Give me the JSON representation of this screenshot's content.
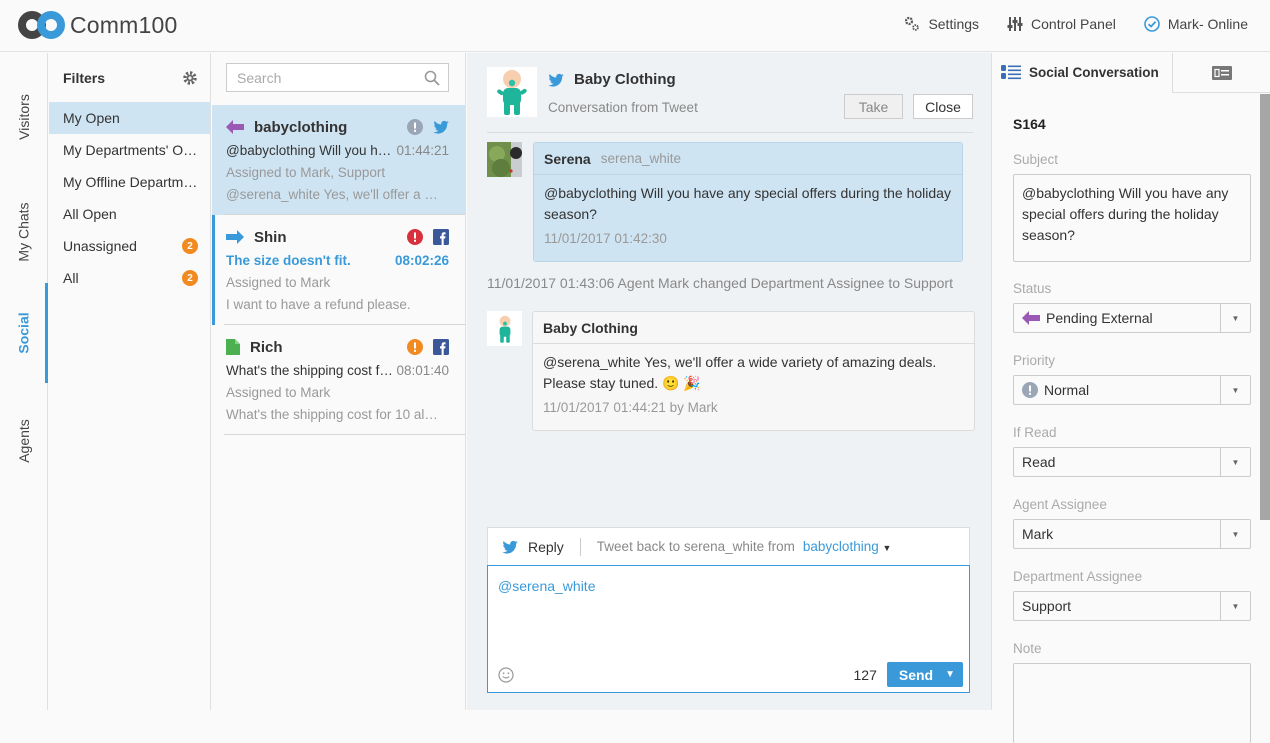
{
  "app": {
    "name": "Comm100"
  },
  "topbar": {
    "actions": [
      {
        "icon": "gears-icon",
        "label": "Settings"
      },
      {
        "icon": "sliders-icon",
        "label": "Control Panel"
      },
      {
        "icon": "check-circle-icon",
        "label": "Mark- Online"
      }
    ]
  },
  "vnav": {
    "items": [
      {
        "label": "Visitors",
        "active": false
      },
      {
        "label": "My Chats",
        "active": false
      },
      {
        "label": "Social",
        "active": true
      },
      {
        "label": "Agents",
        "active": false
      }
    ]
  },
  "filters": {
    "title": "Filters",
    "items": [
      {
        "label": "My Open",
        "active": true,
        "badge": null
      },
      {
        "label": "My Departments' Open",
        "badge": null
      },
      {
        "label": "My Offline Departme…",
        "badge": null
      },
      {
        "label": "All Open",
        "badge": null
      },
      {
        "label": "Unassigned",
        "badge": "2"
      },
      {
        "label": "All",
        "badge": "2"
      }
    ]
  },
  "list": {
    "search_placeholder": "Search",
    "conversations": [
      {
        "name": "babyclothing",
        "status": "pending-external",
        "priority": "normal",
        "channel": "twitter",
        "message": "@babyclothing Will you h…",
        "time": "01:44:21",
        "assigned": "Assigned to Mark, Support",
        "last": "@serena_white Yes, we'll offer a …"
      },
      {
        "name": "Shin",
        "status": "pending-internal",
        "priority": "urgent",
        "channel": "facebook",
        "message": "The size doesn't fit.",
        "time": "08:02:26",
        "assigned": "Assigned to Mark",
        "last": "I want to have a refund please."
      },
      {
        "name": "Rich",
        "status": "new",
        "priority": "high",
        "channel": "facebook",
        "message": "What's the shipping cost f…",
        "time": "08:01:40",
        "assigned": "Assigned to Mark",
        "last": "What's the shipping cost for 10 al…"
      }
    ]
  },
  "chat": {
    "title": "Baby Clothing",
    "subtitle": "Conversation from Tweet",
    "take_label": "Take",
    "close_label": "Close",
    "messages": [
      {
        "author": "Serena",
        "handle": "serena_white",
        "text": "@babyclothing Will you have any special offers during the holiday season?",
        "time": "11/01/2017 01:42:30"
      },
      {
        "author": "Baby Clothing",
        "text": "@serena_white Yes, we'll  offer a wide variety of amazing deals.",
        "text2": "Please stay tuned.",
        "emoji": "🙂 🎉",
        "time": "11/01/2017 01:44:21 by Mark"
      }
    ],
    "system_message": "11/01/2017 01:43:06 Agent Mark changed Department Assignee to Support",
    "reply": {
      "tab_label": "Reply",
      "target": "Tweet back to serena_white from",
      "from_account": "babyclothing",
      "value": "@serena_white",
      "remaining": "127",
      "send_label": "Send"
    }
  },
  "side": {
    "tab_label": "Social Conversation",
    "case_id": "S164",
    "subject_label": "Subject",
    "subject": "@babyclothing Will you have any special offers during the holiday season?",
    "status_label": "Status",
    "status": "Pending External",
    "priority_label": "Priority",
    "priority": "Normal",
    "ifread_label": "If Read",
    "ifread": "Read",
    "agent_label": "Agent Assignee",
    "agent": "Mark",
    "dept_label": "Department Assignee",
    "dept": "Support",
    "note_label": "Note"
  },
  "colors": {
    "accent": "#3a9ad9",
    "pending_external": "#9b59b6",
    "urgent": "#d9303e",
    "high": "#f28a22",
    "normal": "#9aa6b5",
    "facebook": "#3b5998",
    "twitter": "#3a9ad9",
    "new": "#4caf50"
  }
}
